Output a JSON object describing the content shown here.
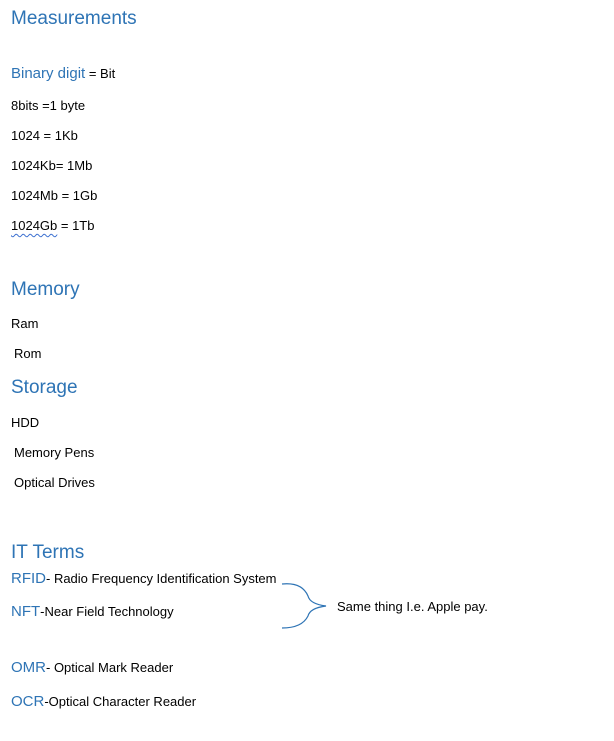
{
  "measurements": {
    "heading": "Measurements",
    "binary": {
      "term": "Binary digit",
      "rest": " = Bit"
    },
    "lines": [
      "8bits =1 byte",
      "1024 = 1Kb",
      "1024Kb= 1Mb",
      "1024Mb = 1Gb"
    ],
    "last": {
      "underlined": "1024Gb",
      "rest": " = 1Tb"
    }
  },
  "memory": {
    "heading": "Memory",
    "items": [
      "Ram",
      "Rom"
    ]
  },
  "storage": {
    "heading": "Storage",
    "items": [
      "HDD",
      "Memory Pens",
      "Optical Drives"
    ]
  },
  "it_terms": {
    "heading": "IT Terms",
    "rfid": {
      "term": "RFID",
      "desc": "- Radio Frequency Identification System"
    },
    "nft": {
      "term": "NFT",
      "desc": "-Near Field Technology"
    },
    "brace_note": "Same thing I.e. Apple pay.",
    "omr": {
      "term": "OMR",
      "desc": "- Optical Mark Reader"
    },
    "ocr": {
      "term": "OCR",
      "desc": "-Optical Character Reader"
    }
  },
  "colors": {
    "heading": "#2e74b5",
    "text": "#000000",
    "spellcheck": "#3b6fd0"
  }
}
